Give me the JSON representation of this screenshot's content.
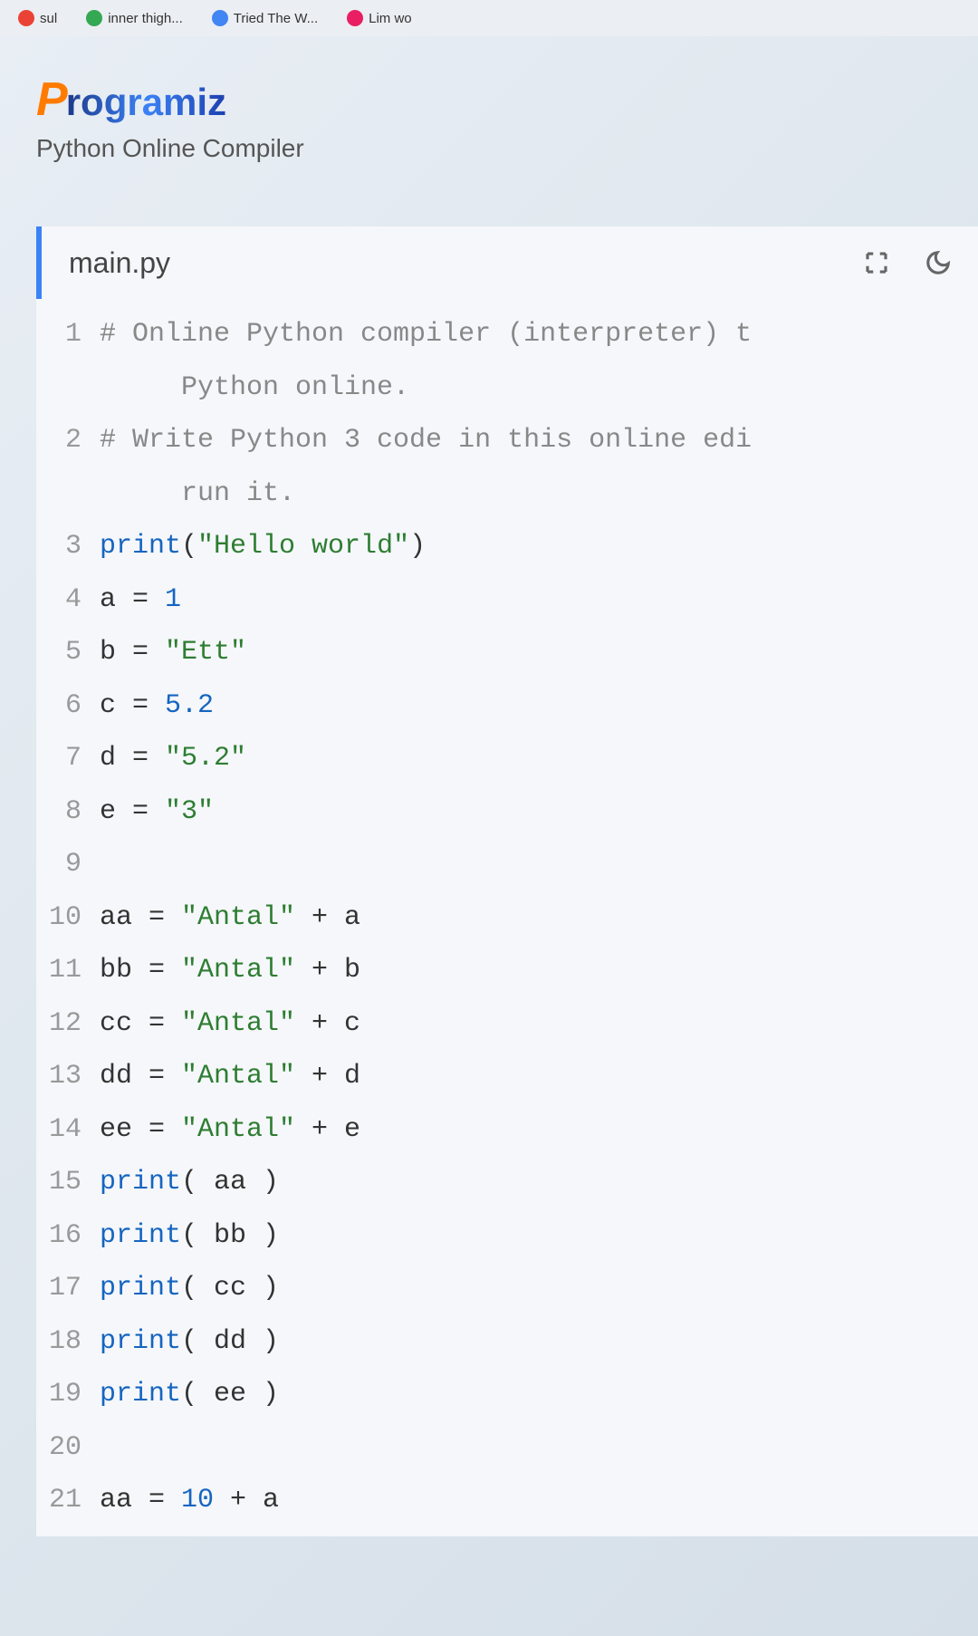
{
  "browser": {
    "tabs": [
      {
        "label": "sul"
      },
      {
        "label": "inner thigh..."
      },
      {
        "label": "Tried The W..."
      },
      {
        "label": "Lim wo"
      }
    ]
  },
  "header": {
    "logo_p": "P",
    "logo_text": "rogramiz",
    "subtitle": "Python Online Compiler"
  },
  "editor": {
    "filename": "main.py",
    "lines": [
      {
        "n": "1",
        "tokens": [
          {
            "t": "comment",
            "v": "# Online Python compiler (interpreter) t"
          }
        ]
      },
      {
        "n": "",
        "tokens": [
          {
            "t": "comment",
            "v": "Python online."
          }
        ],
        "wrapped": true
      },
      {
        "n": "2",
        "tokens": [
          {
            "t": "comment",
            "v": "# Write Python 3 code in this online edi"
          }
        ]
      },
      {
        "n": "",
        "tokens": [
          {
            "t": "comment",
            "v": "run it."
          }
        ],
        "wrapped": true
      },
      {
        "n": "3",
        "tokens": [
          {
            "t": "func",
            "v": "print"
          },
          {
            "t": "",
            "v": "("
          },
          {
            "t": "string",
            "v": "\"Hello world\""
          },
          {
            "t": "",
            "v": ")"
          }
        ]
      },
      {
        "n": "4",
        "tokens": [
          {
            "t": "",
            "v": "a = "
          },
          {
            "t": "number",
            "v": "1"
          }
        ]
      },
      {
        "n": "5",
        "tokens": [
          {
            "t": "",
            "v": "b = "
          },
          {
            "t": "string",
            "v": "\"Ett\""
          }
        ]
      },
      {
        "n": "6",
        "tokens": [
          {
            "t": "",
            "v": "c = "
          },
          {
            "t": "number",
            "v": "5.2"
          }
        ]
      },
      {
        "n": "7",
        "tokens": [
          {
            "t": "",
            "v": "d = "
          },
          {
            "t": "string",
            "v": "\"5.2\""
          }
        ]
      },
      {
        "n": "8",
        "tokens": [
          {
            "t": "",
            "v": "e = "
          },
          {
            "t": "string",
            "v": "\"3\""
          }
        ]
      },
      {
        "n": "9",
        "tokens": []
      },
      {
        "n": "10",
        "tokens": [
          {
            "t": "",
            "v": "aa = "
          },
          {
            "t": "string",
            "v": "\"Antal\""
          },
          {
            "t": "",
            "v": " + a"
          }
        ]
      },
      {
        "n": "11",
        "tokens": [
          {
            "t": "",
            "v": "bb = "
          },
          {
            "t": "string",
            "v": "\"Antal\""
          },
          {
            "t": "",
            "v": " + b"
          }
        ]
      },
      {
        "n": "12",
        "tokens": [
          {
            "t": "",
            "v": "cc = "
          },
          {
            "t": "string",
            "v": "\"Antal\""
          },
          {
            "t": "",
            "v": " + c"
          }
        ]
      },
      {
        "n": "13",
        "tokens": [
          {
            "t": "",
            "v": "dd = "
          },
          {
            "t": "string",
            "v": "\"Antal\""
          },
          {
            "t": "",
            "v": " + d"
          }
        ]
      },
      {
        "n": "14",
        "tokens": [
          {
            "t": "",
            "v": "ee = "
          },
          {
            "t": "string",
            "v": "\"Antal\""
          },
          {
            "t": "",
            "v": " + e"
          }
        ]
      },
      {
        "n": "15",
        "tokens": [
          {
            "t": "func",
            "v": "print"
          },
          {
            "t": "",
            "v": "( aa )"
          }
        ]
      },
      {
        "n": "16",
        "tokens": [
          {
            "t": "func",
            "v": "print"
          },
          {
            "t": "",
            "v": "( bb )"
          }
        ]
      },
      {
        "n": "17",
        "tokens": [
          {
            "t": "func",
            "v": "print"
          },
          {
            "t": "",
            "v": "( cc )"
          }
        ]
      },
      {
        "n": "18",
        "tokens": [
          {
            "t": "func",
            "v": "print"
          },
          {
            "t": "",
            "v": "( dd )"
          }
        ]
      },
      {
        "n": "19",
        "tokens": [
          {
            "t": "func",
            "v": "print"
          },
          {
            "t": "",
            "v": "( ee )"
          }
        ]
      },
      {
        "n": "20",
        "tokens": []
      },
      {
        "n": "21",
        "tokens": [
          {
            "t": "",
            "v": "aa = "
          },
          {
            "t": "number",
            "v": "10"
          },
          {
            "t": "",
            "v": " + a"
          }
        ]
      }
    ]
  }
}
